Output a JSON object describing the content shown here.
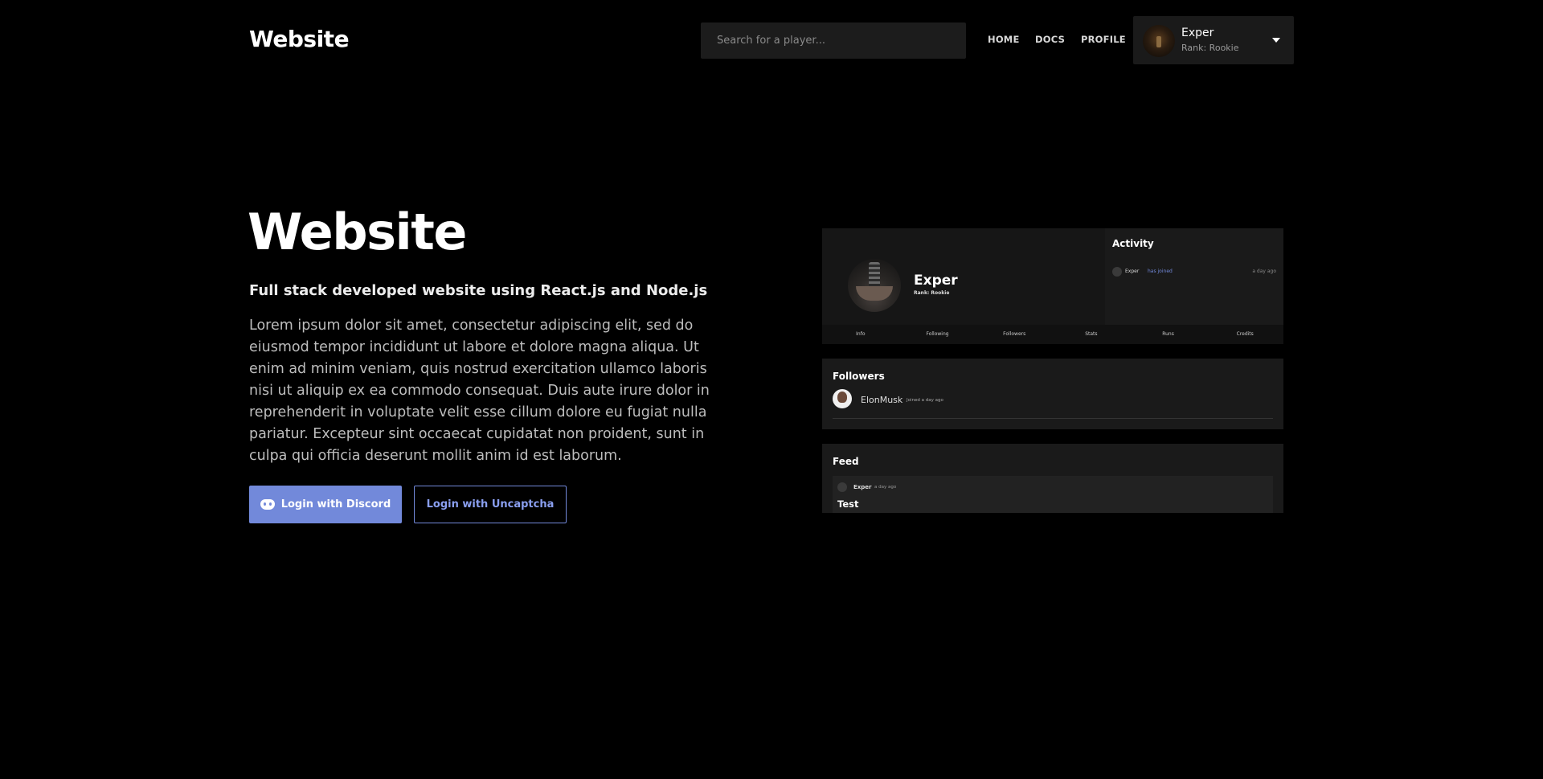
{
  "nav": {
    "brand": "Website",
    "search_placeholder": "Search for a player...",
    "links": [
      "HOME",
      "DOCS",
      "PROFILE"
    ],
    "user": {
      "name": "Exper",
      "rank": "Rank: Rookie"
    }
  },
  "hero": {
    "title": "Website",
    "subtitle": "Full stack developed website using React.js and Node.js",
    "body": "Lorem ipsum dolor sit amet, consectetur adipiscing elit, sed do eiusmod tempor incididunt ut labore et dolore magna aliqua. Ut enim ad minim veniam, quis nostrud exercitation ullamco laboris nisi ut aliquip ex ea commodo consequat. Duis aute irure dolor in reprehenderit in voluptate velit esse cillum dolore eu fugiat nulla pariatur. Excepteur sint occaecat cupidatat non proident, sunt in culpa qui officia deserunt mollit anim id est laborum.",
    "discord_button": "Login with Discord",
    "uncaptcha_button": "Login with Uncaptcha"
  },
  "preview": {
    "profile": {
      "name": "Exper",
      "rank": "Rank: Rookie"
    },
    "activity": {
      "title": "Activity",
      "user": "Exper",
      "action": "has joined",
      "time": "a day ago"
    },
    "tabs": [
      "Info",
      "Following",
      "Followers",
      "Stats",
      "Runs",
      "Credits"
    ],
    "followers": {
      "title": "Followers",
      "name": "ElonMusk",
      "time": "Joined a day ago"
    },
    "feed": {
      "title": "Feed",
      "user": "Exper",
      "time": "a day ago",
      "post_title": "Test"
    }
  },
  "colors": {
    "accent": "#7289da",
    "background": "#000000",
    "panel": "#1a1a1a"
  }
}
